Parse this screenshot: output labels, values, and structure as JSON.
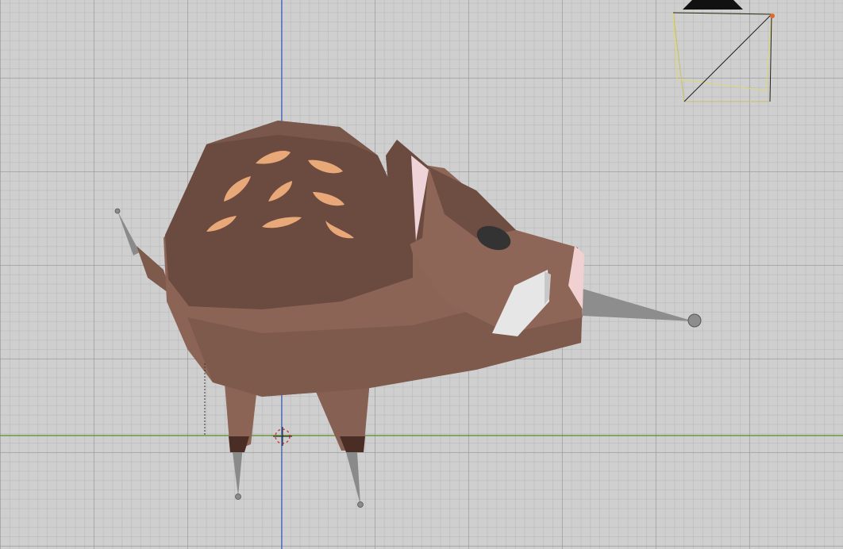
{
  "viewport": {
    "background": "#cfcfcf",
    "grid_color": "#9a9a9a",
    "x_axis_color": "#5a8a2a",
    "z_axis_color": "#3a5fbf"
  },
  "scene_objects": {
    "boar_body_color": "#8b6456",
    "boar_back_color": "#6b4a40",
    "spot_color": "#e8a878",
    "tusk_color": "#e8e8e8",
    "snout_color": "#f0d0d0",
    "eye_color": "#333333",
    "bone_color": "#8a8a8a",
    "camera_color": "#e8e066",
    "cursor_color": "#cc4444"
  }
}
